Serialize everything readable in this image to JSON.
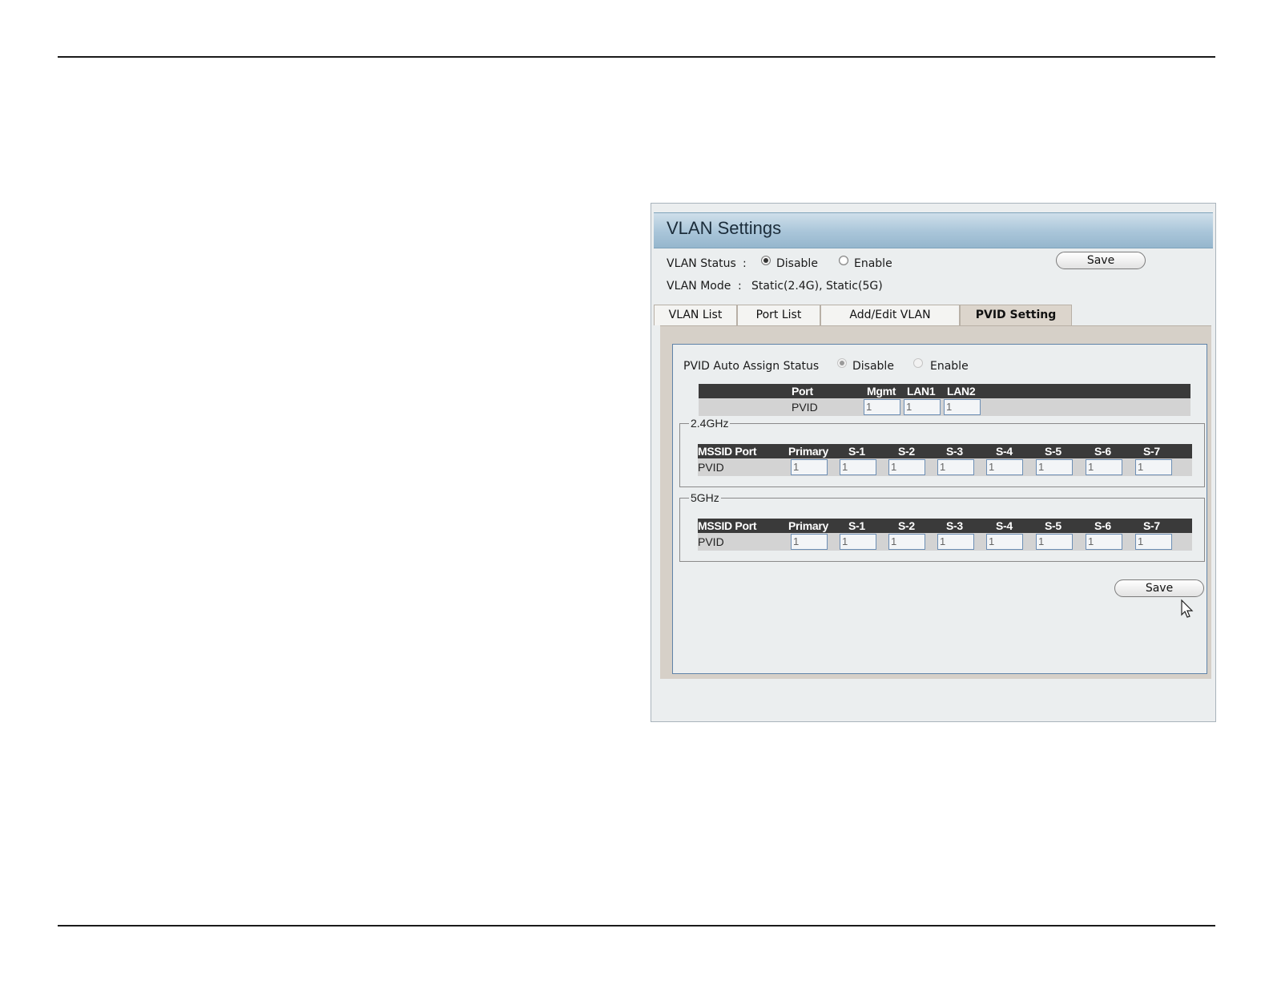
{
  "panel": {
    "title": "VLAN Settings",
    "vlan_status": {
      "label": "VLAN Status",
      "sep": ":",
      "options": [
        "Disable",
        "Enable"
      ],
      "selected": "Disable"
    },
    "vlan_mode": {
      "label": "VLAN Mode",
      "sep": ":",
      "value": "Static(2.4G),  Static(5G)"
    },
    "save_top": "Save",
    "tabs": [
      "VLAN List",
      "Port List",
      "Add/Edit VLAN",
      "PVID Setting"
    ],
    "active_tab": "PVID Setting"
  },
  "pvid": {
    "auto_assign_label": "PVID Auto Assign Status",
    "auto_assign_options": [
      "Disable",
      "Enable"
    ],
    "auto_assign_selected": "Disable",
    "port_table": {
      "headers": [
        "Port",
        "Mgmt",
        "LAN1",
        "LAN2"
      ],
      "row_label": "PVID",
      "values": [
        "1",
        "1",
        "1"
      ]
    },
    "band_24": {
      "legend": "2.4GHz",
      "headers": [
        "MSSID Port",
        "Primary",
        "S-1",
        "S-2",
        "S-3",
        "S-4",
        "S-5",
        "S-6",
        "S-7"
      ],
      "row_label": "PVID",
      "values": [
        "1",
        "1",
        "1",
        "1",
        "1",
        "1",
        "1",
        "1"
      ]
    },
    "band_5": {
      "legend": "5GHz",
      "headers": [
        "MSSID Port",
        "Primary",
        "S-1",
        "S-2",
        "S-3",
        "S-4",
        "S-5",
        "S-6",
        "S-7"
      ],
      "row_label": "PVID",
      "values": [
        "1",
        "1",
        "1",
        "1",
        "1",
        "1",
        "1",
        "1"
      ]
    },
    "save_bottom": "Save"
  },
  "colors": {
    "title_gradient_top": "#cfdfea",
    "title_gradient_bottom": "#95b6cd",
    "table_header": "#3a3a3a",
    "table_row": "#d3d3d3",
    "input_border": "#6d8fb5"
  }
}
